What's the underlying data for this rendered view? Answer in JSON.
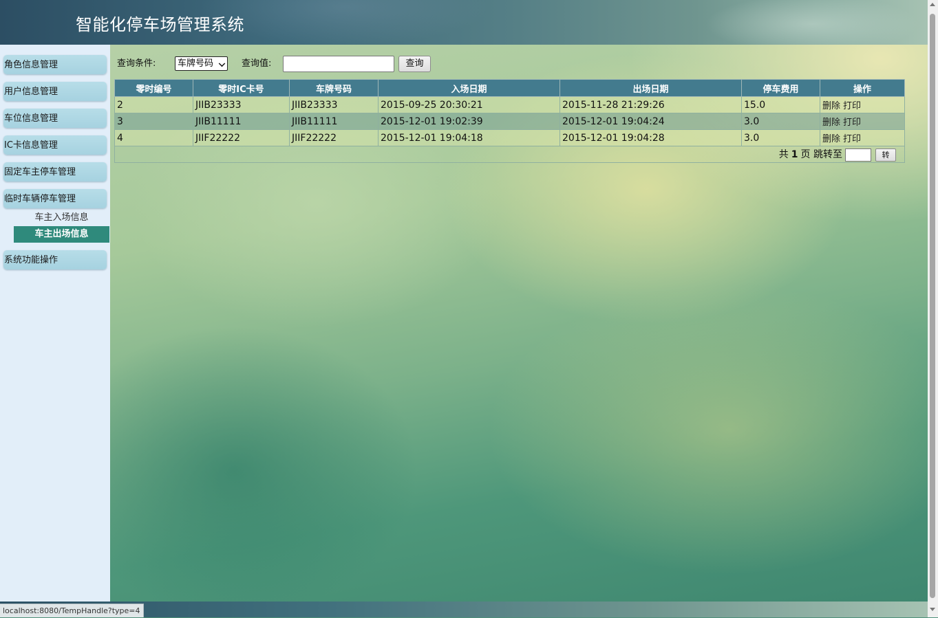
{
  "header": {
    "title": "智能化停车场管理系统"
  },
  "sidebar": {
    "items": [
      {
        "label": "角色信息管理"
      },
      {
        "label": "用户信息管理"
      },
      {
        "label": "车位信息管理"
      },
      {
        "label": "IC卡信息管理"
      },
      {
        "label": "固定车主停车管理"
      },
      {
        "label": "临时车辆停车管理"
      },
      {
        "label": "系统功能操作"
      }
    ],
    "sub_items": [
      {
        "label": "车主入场信息",
        "active": false
      },
      {
        "label": "车主出场信息",
        "active": true
      }
    ]
  },
  "query": {
    "condition_label": "查询条件:",
    "condition_selected": "车牌号码",
    "value_label": "查询值:",
    "value": "",
    "button_label": "查询"
  },
  "table": {
    "columns": [
      "零时编号",
      "零时IC卡号",
      "车牌号码",
      "入场日期",
      "出场日期",
      "停车费用",
      "操作"
    ],
    "rows": [
      {
        "id": "2",
        "card": "JIIB23333",
        "plate": "JIIB23333",
        "entry": "2015-09-25 20:30:21",
        "exit": "2015-11-28 21:29:26",
        "fee": "15.0"
      },
      {
        "id": "3",
        "card": "JIIB11111",
        "plate": "JIIB11111",
        "entry": "2015-12-01 19:02:39",
        "exit": "2015-12-01 19:04:24",
        "fee": "3.0"
      },
      {
        "id": "4",
        "card": "JIIF22222",
        "plate": "JIIF22222",
        "entry": "2015-12-01 19:04:18",
        "exit": "2015-12-01 19:04:28",
        "fee": "3.0"
      }
    ],
    "actions": {
      "delete": "删除",
      "print": "打印"
    }
  },
  "pager": {
    "total_prefix": "共",
    "total_pages": "1",
    "total_suffix": "页 跳转至",
    "jump_value": "",
    "go_label": "转"
  },
  "status_bar": {
    "url": "localhost:8080/TempHandle?type=4"
  }
}
